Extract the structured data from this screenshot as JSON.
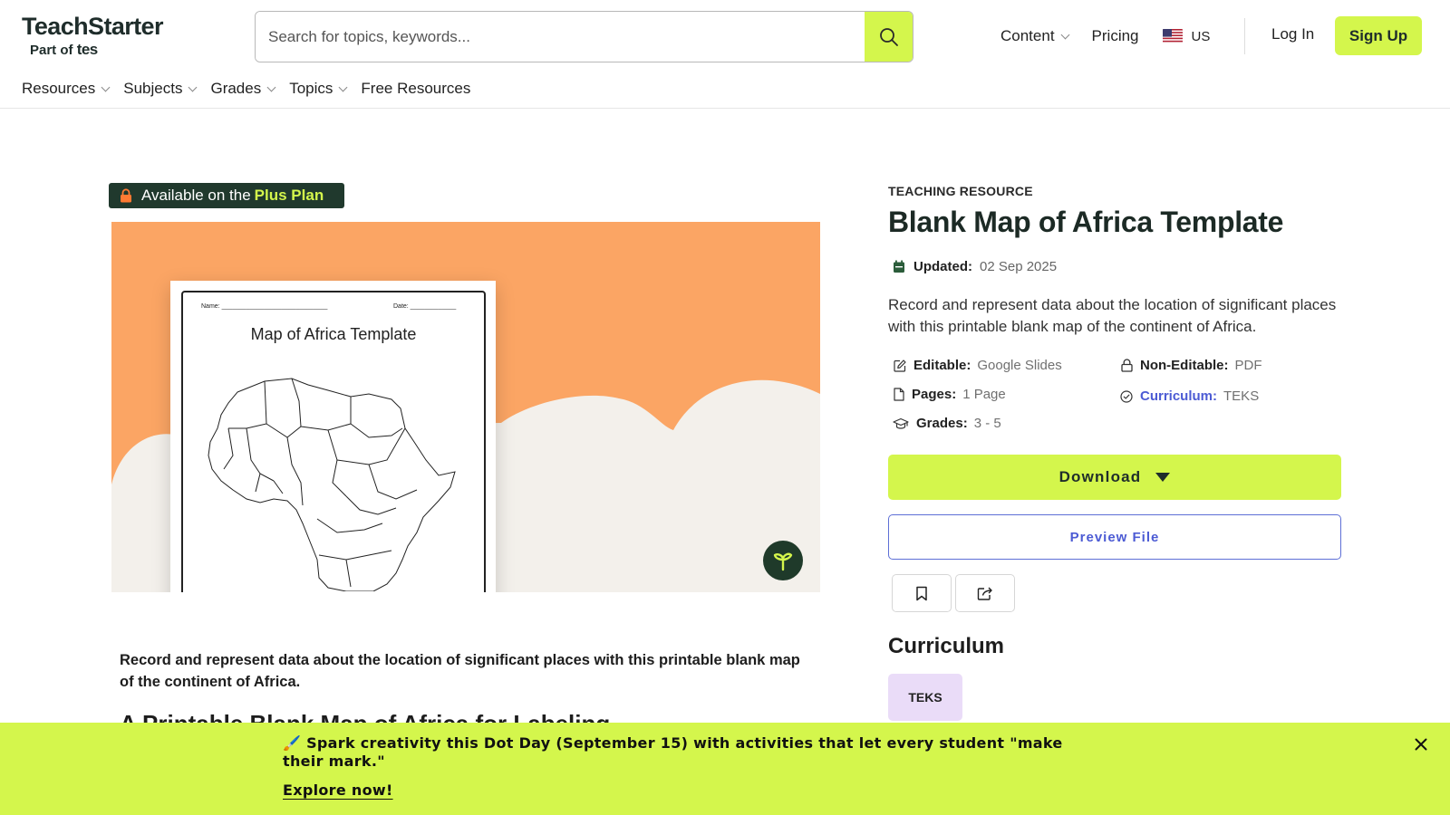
{
  "brand": {
    "name": "TeachStarter",
    "sub_prefix": "Part of",
    "sub_brand": "tes"
  },
  "search": {
    "placeholder": "Search for topics, keywords...",
    "value": ""
  },
  "top_nav": {
    "content": "Content",
    "pricing": "Pricing",
    "region": "US",
    "login": "Log In",
    "signup": "Sign Up"
  },
  "sub_nav": [
    "Resources",
    "Subjects",
    "Grades",
    "Topics",
    "Free Resources"
  ],
  "badge": {
    "prefix": "Available on the",
    "plan": "Plus Plan"
  },
  "preview_image": {
    "name_label": "Name:",
    "date_label": "Date:",
    "title": "Map of Africa Template"
  },
  "resource": {
    "kicker": "TEACHING RESOURCE",
    "title": "Blank Map of Africa Template",
    "updated_label": "Updated:",
    "updated_value": "02 Sep 2025",
    "description": "Record and represent data about the location of significant places with this printable blank map of the continent of Africa.",
    "meta": {
      "editable_label": "Editable:",
      "editable_value": "Google Slides",
      "noneditable_label": "Non-Editable:",
      "noneditable_value": "PDF",
      "pages_label": "Pages:",
      "pages_value": "1 Page",
      "curriculum_label": "Curriculum:",
      "curriculum_value": "TEKS",
      "grades_label": "Grades:",
      "grades_value": "3 - 5"
    },
    "download_label": "Download",
    "preview_label": "Preview File"
  },
  "curriculum": {
    "heading": "Curriculum",
    "chip": "TEKS"
  },
  "body": {
    "intro": "Record and represent data about the location of significant places with this printable blank map of the continent of Africa.",
    "heading": "A Printable Blank Map of Africa for Labeling"
  },
  "banner": {
    "text": "🖌️ Spark creativity this Dot Day (September 15) with activities that let every student \"make their mark.\"",
    "link": "Explore now!"
  },
  "colors": {
    "accent": "#d4f64c",
    "hero_bg": "#fba564",
    "badge_bg": "#20392d",
    "link": "#4c5bd4",
    "chip_bg": "#eadcf8"
  }
}
